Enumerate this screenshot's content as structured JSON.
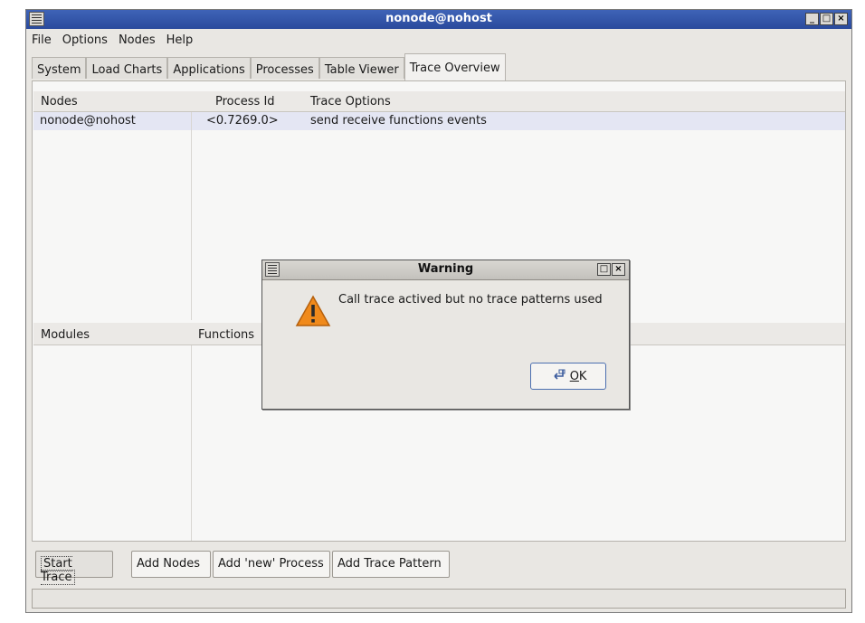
{
  "window": {
    "title": "nonode@nohost"
  },
  "menu": [
    "File",
    "Options",
    "Nodes",
    "Help"
  ],
  "tabs": [
    "System",
    "Load Charts",
    "Applications",
    "Processes",
    "Table Viewer",
    "Trace Overview"
  ],
  "top_table": {
    "headers": {
      "nodes": "Nodes",
      "pid": "Process Id",
      "opts": "Trace Options"
    },
    "row": {
      "node": "nonode@nohost",
      "pid": "<0.7269.0>",
      "opts": "send receive functions events"
    }
  },
  "bottom_table": {
    "headers": {
      "modules": "Modules",
      "functions": "Functions"
    }
  },
  "buttons": {
    "start": "Start Trace",
    "add_nodes": "Add Nodes",
    "add_process": "Add 'new' Process",
    "add_pattern": "Add Trace Pattern"
  },
  "dialog": {
    "title": "Warning",
    "message": "Call trace actived but no trace patterns used",
    "ok": "OK",
    "ok_underline": "O",
    "ok_rest": "K"
  },
  "icons": {
    "warning": "warning-icon",
    "ok": "ok-icon"
  },
  "colors": {
    "titlebar": "#2f52a8",
    "selection": "#e4e6f3",
    "warning": "#f08a1c"
  }
}
